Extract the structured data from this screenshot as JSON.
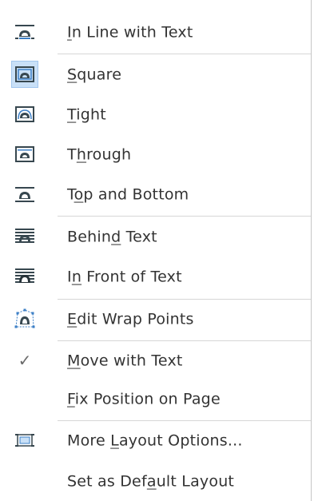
{
  "menu": {
    "items": [
      {
        "icon": "wrap-inline-icon",
        "pre": "",
        "mn": "I",
        "post": "n Line with Text",
        "selected": false
      },
      {
        "icon": "wrap-square-icon",
        "pre": "",
        "mn": "S",
        "post": "quare",
        "selected": true
      },
      {
        "icon": "wrap-tight-icon",
        "pre": "",
        "mn": "T",
        "post": "ight",
        "selected": false
      },
      {
        "icon": "wrap-through-icon",
        "pre": "T",
        "mn": "h",
        "post": "rough",
        "selected": false
      },
      {
        "icon": "wrap-top-bottom-icon",
        "pre": "T",
        "mn": "o",
        "post": "p and Bottom",
        "selected": false
      },
      {
        "icon": "wrap-behind-text-icon",
        "pre": "Behin",
        "mn": "d",
        "post": " Text",
        "selected": false
      },
      {
        "icon": "wrap-in-front-icon",
        "pre": "I",
        "mn": "n",
        "post": " Front of Text",
        "selected": false
      },
      {
        "icon": "edit-wrap-points-icon",
        "pre": "",
        "mn": "E",
        "post": "dit Wrap Points",
        "selected": false
      },
      {
        "icon": "checkmark-icon",
        "pre": "",
        "mn": "M",
        "post": "ove with Text",
        "selected": false
      },
      {
        "icon": "",
        "pre": "",
        "mn": "F",
        "post": "ix Position on Page",
        "selected": false
      },
      {
        "icon": "layout-options-icon",
        "pre": "More ",
        "mn": "L",
        "post": "ayout Options...",
        "selected": false
      },
      {
        "icon": "",
        "pre": "Set as Def",
        "mn": "a",
        "post": "ult Layout",
        "selected": false
      }
    ],
    "check_glyph": "✓",
    "colors": {
      "icon_dark": "#37474f",
      "icon_blue": "#3c7fc6",
      "selected_bg": "#c9e0f7",
      "selected_border": "#a2c6ee",
      "separator": "#d6d6d6"
    }
  }
}
